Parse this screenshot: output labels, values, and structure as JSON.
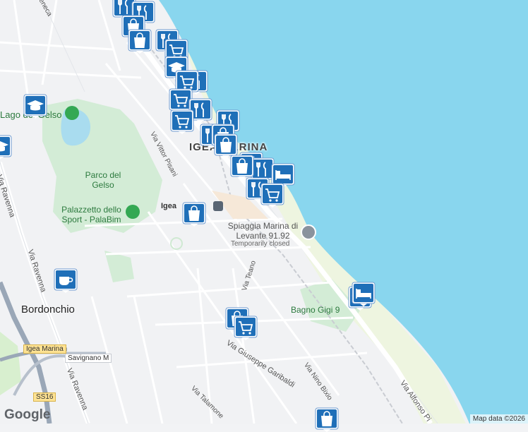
{
  "map": {
    "colors": {
      "water": "#89d6ee",
      "land": "#f1f2f4",
      "park": "#d3ecd6",
      "road": "#ffffff",
      "road_outline": "#dcdfe4",
      "highway": "#aab4c2",
      "sand": "#fff2c8",
      "marker": "#1f6fb8"
    },
    "places": {
      "igea_marina": "IGEA MARINA",
      "bordonchio": "Bordonchio",
      "parco": "Parco del Gelso",
      "lago": "Lago del Gelso",
      "palazzetto": "Palazzetto dello Sport - PalaBim",
      "spiaggia": "Spiaggia Marina di Levante 91.92",
      "spiaggia_status": "Temporarily closed",
      "bagno_gigi": "Bagno Gigi 9",
      "igea_station": "Igea"
    },
    "streets": {
      "vittor_pisani": "Via Vittor Pisani",
      "ravenna_left": "Via Ravenna",
      "ravenna_mid": "Via Ravenna",
      "ravenna_bottom": "Via Ravenna",
      "teano": "Via Teano",
      "garibaldi": "Via Giuseppe Garibaldi",
      "nino_bixio": "Via Nino Bixio",
      "talamone": "Via Talamone",
      "alfonso": "Via Alfonso Pi",
      "seneca": "eneca"
    },
    "road_shields": {
      "igea_marina": "Igea Marina",
      "savignano": "Savignano M",
      "ss16": "SS16"
    },
    "attribution": "Map data ©2026",
    "logo": "Google",
    "markers": [
      {
        "icon": "fork-knife-icon"
      },
      {
        "icon": "fork-knife-icon"
      },
      {
        "icon": "shopping-bag-icon"
      },
      {
        "icon": "shopping-bag-icon"
      },
      {
        "icon": "fork-knife-icon"
      },
      {
        "icon": "shopping-cart-icon"
      },
      {
        "icon": "graduation-cap-icon"
      },
      {
        "icon": "fork-knife-icon"
      },
      {
        "icon": "shopping-cart-icon"
      },
      {
        "icon": "shopping-cart-icon"
      },
      {
        "icon": "fork-knife-icon"
      },
      {
        "icon": "shopping-cart-icon"
      },
      {
        "icon": "fork-knife-icon"
      },
      {
        "icon": "fork-knife-icon"
      },
      {
        "icon": "shopping-bag-icon"
      },
      {
        "icon": "shopping-bag-icon"
      },
      {
        "icon": "fork-knife-icon"
      },
      {
        "icon": "fork-knife-icon"
      },
      {
        "icon": "shopping-bag-icon"
      },
      {
        "icon": "bed-icon"
      },
      {
        "icon": "fork-knife-icon"
      },
      {
        "icon": "shopping-cart-icon"
      },
      {
        "icon": "shopping-bag-icon"
      },
      {
        "icon": "graduation-cap-icon"
      },
      {
        "icon": "graduation-cap-icon"
      },
      {
        "icon": "bed-icon"
      },
      {
        "icon": "coffee-cup-icon"
      },
      {
        "icon": "graduation-cap-icon"
      },
      {
        "icon": "shopping-bag-icon"
      },
      {
        "icon": "shopping-cart-icon"
      },
      {
        "icon": "shopping-bag-icon"
      }
    ]
  }
}
